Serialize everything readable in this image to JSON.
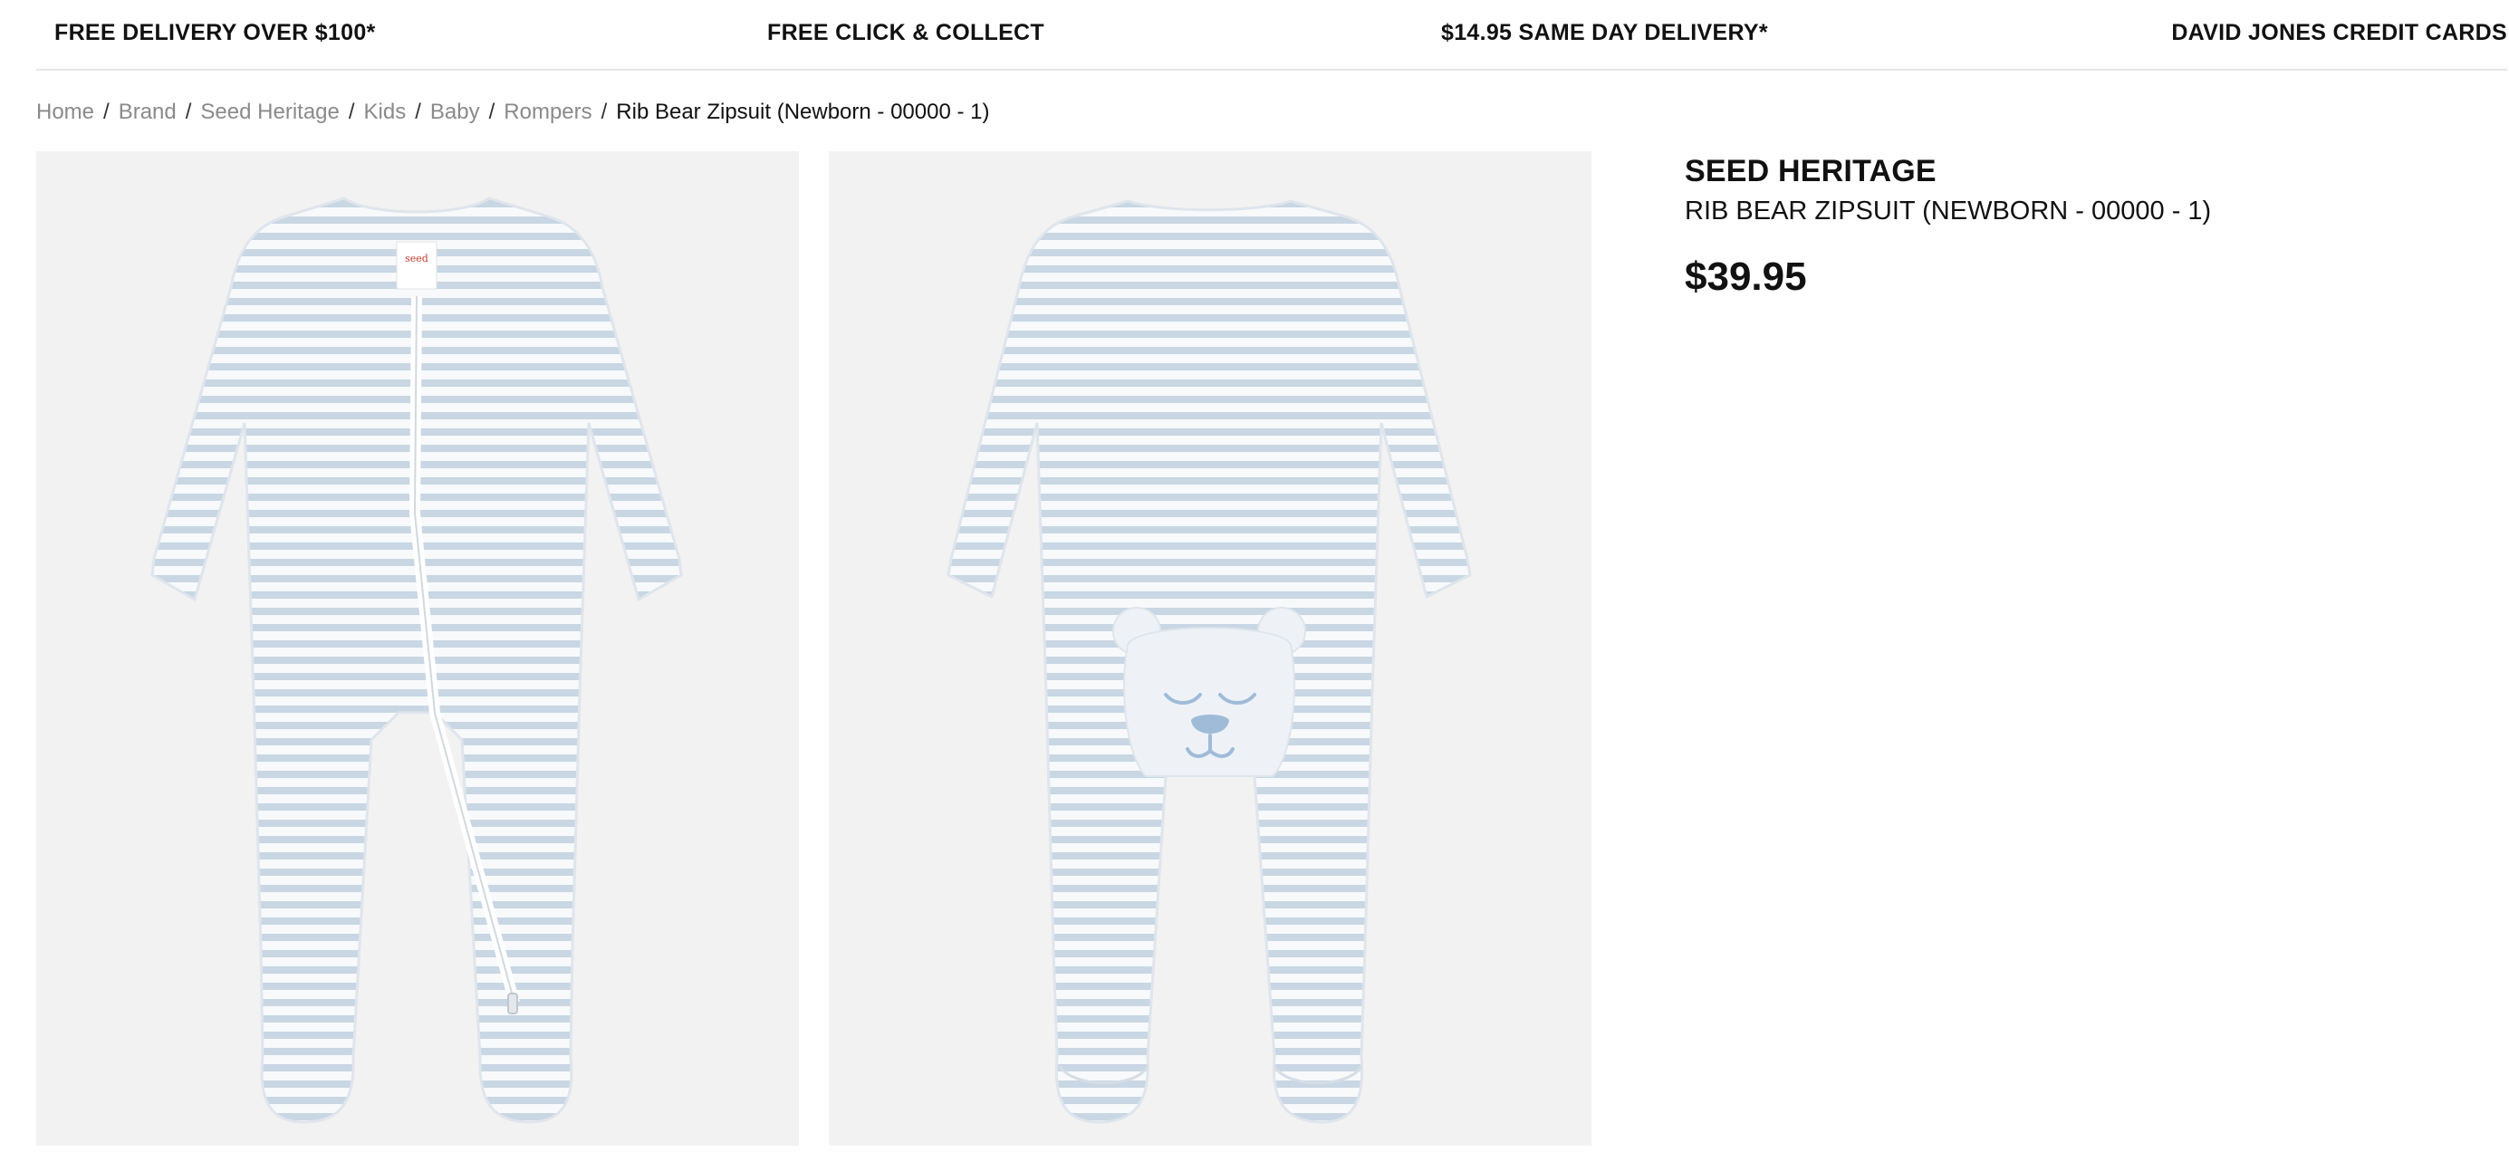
{
  "promo_bar": {
    "items": [
      "FREE DELIVERY OVER $100*",
      "FREE CLICK & COLLECT",
      "$14.95 SAME DAY DELIVERY*",
      "DAVID JONES CREDIT CARDS"
    ]
  },
  "breadcrumb": {
    "items": [
      "Home",
      "Brand",
      "Seed Heritage",
      "Kids",
      "Baby",
      "Rompers"
    ],
    "separator": "/",
    "current": "Rib Bear Zipsuit (Newborn - 00000 - 1)"
  },
  "gallery": {
    "images": [
      {
        "view": "front",
        "label_text": "seed"
      },
      {
        "view": "back"
      }
    ],
    "colors": {
      "background": "#f2f2f2",
      "garment": "#f7f9fb",
      "stripe": "#c9d6e3",
      "bear_feature": "#9fbbd8"
    }
  },
  "product": {
    "brand": "SEED HERITAGE",
    "name": "RIB BEAR ZIPSUIT (NEWBORN - 00000 - 1)",
    "price": "$39.95"
  }
}
